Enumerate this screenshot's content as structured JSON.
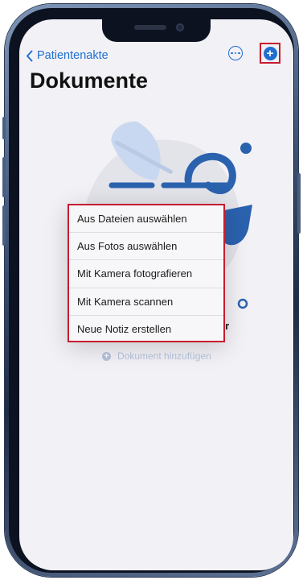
{
  "nav": {
    "back_label": "Patientenakte",
    "more_icon": "ellipsis-circle-icon",
    "add_icon": "plus-circle-icon",
    "accent": "#1f6fd1"
  },
  "page": {
    "title": "Dokumente",
    "empty_state_text": "leer",
    "add_document_label": "Dokument hinzufügen"
  },
  "menu": {
    "items": [
      "Aus Dateien auswählen",
      "Aus Fotos auswählen",
      "Mit Kamera fotografieren",
      "Mit Kamera scannen",
      "Neue Notiz erstellen"
    ]
  },
  "highlight_color": "#c41e2e"
}
